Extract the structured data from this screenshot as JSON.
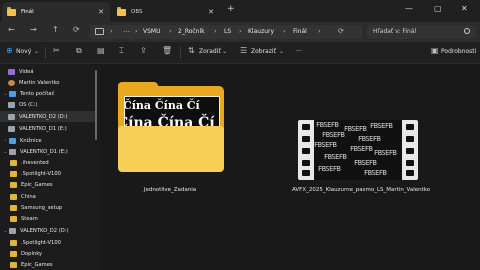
{
  "tabs": [
    {
      "label": "Finál",
      "active": true
    },
    {
      "label": "OBS",
      "active": false
    }
  ],
  "window_controls": {
    "minimize": "—",
    "maximize": "▢",
    "close": "✕"
  },
  "nav": {
    "back": "←",
    "forward": "→",
    "up": "↑",
    "refresh": "⟳"
  },
  "address": {
    "overflow": "…",
    "crumbs": [
      "VSMU",
      "2_Ročník",
      "LS",
      "Klauzury",
      "Finál"
    ],
    "separator": "›"
  },
  "search": {
    "placeholder": "Hľadať v: Finál"
  },
  "commands": {
    "new": "Nový",
    "sort": "Zoradiť",
    "view": "Zobraziť",
    "more": "···",
    "details": "Podrobnosti"
  },
  "sidebar": {
    "items": [
      {
        "label": "Videá",
        "icon": "purple"
      },
      {
        "label": "Martin Valentko",
        "icon": "person"
      },
      {
        "label": "Tento počítač",
        "icon": "pc"
      },
      {
        "label": "OS (C:)",
        "icon": "drive"
      },
      {
        "label": "VALENTKO_D2 (D:)",
        "icon": "drive"
      },
      {
        "label": "VALENTKO_D1 (E:)",
        "icon": "drive"
      },
      {
        "label": "Knižnice",
        "icon": "lib"
      },
      {
        "label": "VALENTKO_D1 (E:)",
        "icon": "drive"
      },
      {
        "label": ".ihevented",
        "icon": "folder"
      },
      {
        "label": ".Spotlight-V100",
        "icon": "folder"
      },
      {
        "label": "Epic_Games",
        "icon": "folder"
      },
      {
        "label": "China",
        "icon": "folder"
      },
      {
        "label": "Samsung_setup",
        "icon": "folder"
      },
      {
        "label": "Steam",
        "icon": "folder"
      },
      {
        "label": "VALENTKO_D2 (D:)",
        "icon": "drive"
      },
      {
        "label": ".Spotlight-V100",
        "icon": "folder"
      },
      {
        "label": "Doplnky",
        "icon": "folder"
      },
      {
        "label": "Epic_Games",
        "icon": "folder"
      }
    ]
  },
  "files": [
    {
      "name": "Jednotlive_Zadania",
      "type": "folder",
      "preview_text": "Čína Čína Čí"
    },
    {
      "name": "AVFX_2025_Klauzurne_pasmo_LS_Martin_Valentko",
      "type": "video",
      "preview_text": "FBSEFB"
    }
  ],
  "colors": {
    "accent": "#4a9de8",
    "folder": "#f7cf56"
  }
}
